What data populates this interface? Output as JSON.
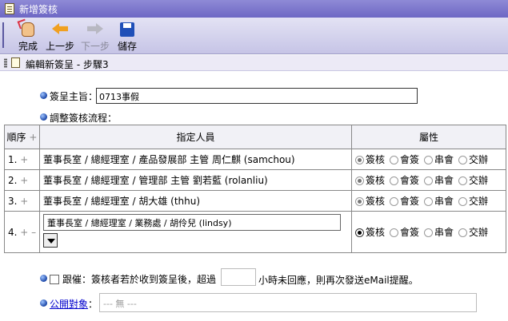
{
  "window": {
    "title": "新增簽核"
  },
  "toolbar": {
    "done": "完成",
    "prev": "上一步",
    "next": "下一步",
    "save": "儲存"
  },
  "step": {
    "title": "編輯新簽呈 - 步驟3"
  },
  "form": {
    "subject_label": "簽呈主旨：",
    "subject_value": "0713事假",
    "flow_label": "調整簽核流程："
  },
  "table": {
    "headers": {
      "order": "順序",
      "assignee": "指定人員",
      "attr": "屬性"
    },
    "add_symbol": "+",
    "remove_symbol": "–",
    "attr_options": [
      "簽核",
      "會簽",
      "串會",
      "交辦"
    ],
    "rows": [
      {
        "order": "1.",
        "assignee": "董事長室 / 總經理室 / 產品發展部 主管 周仁麒 (samchou)",
        "selected": "簽核"
      },
      {
        "order": "2.",
        "assignee": "董事長室 / 總經理室 / 管理部 主管 劉若藍 (rolanliu)",
        "selected": "簽核"
      },
      {
        "order": "3.",
        "assignee": "董事長室 / 總經理室 / 胡大雄 (thhu)",
        "selected": "簽核"
      },
      {
        "order": "4.",
        "assignee": "董事長室 / 總經理室 / 業務處 / 胡伶兒 (lindsy)",
        "selected": "簽核"
      }
    ]
  },
  "reminder": {
    "label": "跟催：",
    "text_before": "簽核者若於收到簽呈後，超過",
    "text_after": "小時未回應，則再次發送eMail提醒。"
  },
  "public": {
    "link": "公開對象",
    "colon": "：",
    "placeholder": "--- 無 ---"
  }
}
